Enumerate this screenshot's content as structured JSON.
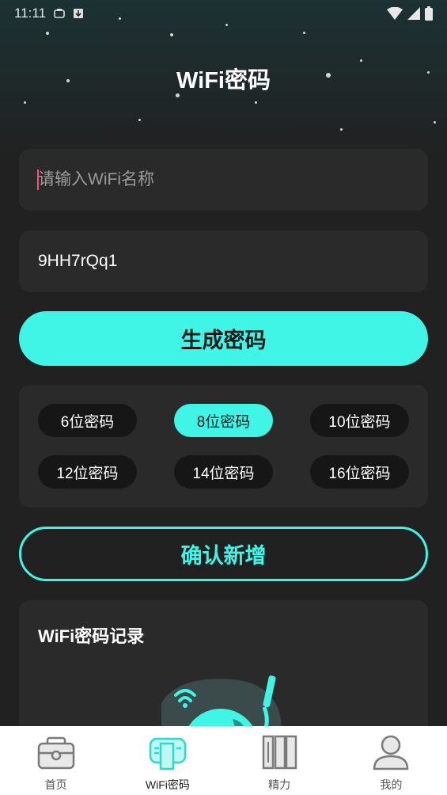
{
  "status_bar": {
    "time": "11:11"
  },
  "page": {
    "title": "WiFi密码"
  },
  "form": {
    "wifi_name_placeholder": "请输入WiFi名称",
    "password_value": "9HH7rQq1"
  },
  "buttons": {
    "generate_label": "生成密码",
    "confirm_label": "确认新增"
  },
  "length_options": [
    {
      "label": "6位密码",
      "selected": false
    },
    {
      "label": "8位密码",
      "selected": true
    },
    {
      "label": "10位密码",
      "selected": false
    },
    {
      "label": "12位密码",
      "selected": false
    },
    {
      "label": "14位密码",
      "selected": false
    },
    {
      "label": "16位密码",
      "selected": false
    }
  ],
  "records": {
    "title": "WiFi密码记录"
  },
  "tabs": [
    {
      "label": "首页",
      "icon": "toolbox-icon",
      "active": false
    },
    {
      "label": "WiFi密码",
      "icon": "router-icon",
      "active": true
    },
    {
      "label": "精力",
      "icon": "books-icon",
      "active": false
    },
    {
      "label": "我的",
      "icon": "user-icon",
      "active": false
    }
  ],
  "colors": {
    "accent": "#40f4e6",
    "background": "#212121",
    "card": "#2a2a2a",
    "chip": "#161616",
    "cursor": "#ff4d7a"
  }
}
